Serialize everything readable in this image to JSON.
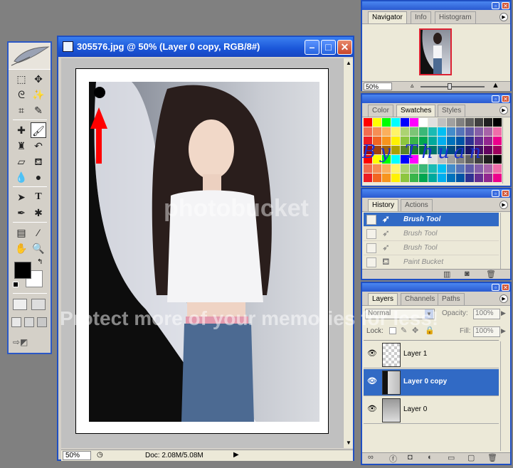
{
  "document": {
    "title": "305576.jpg @ 50% (Layer 0 copy, RGB/8#)",
    "zoom": "50%",
    "doc_size": "Doc: 2.08M/5.08M"
  },
  "navigator": {
    "tabs": [
      "Navigator",
      "Info",
      "Histogram"
    ],
    "zoom": "50%"
  },
  "color_panel": {
    "tabs": [
      "Color",
      "Swatches",
      "Styles"
    ],
    "signature": "By Thuan",
    "swatch_colors": [
      "#ff0000",
      "#ffff00",
      "#00ff00",
      "#00ffff",
      "#0000ff",
      "#ff00ff",
      "#ffffff",
      "#e0e0e0",
      "#c0c0c0",
      "#a0a0a0",
      "#808080",
      "#606060",
      "#404040",
      "#202020",
      "#000000",
      "#f26c4f",
      "#f68e55",
      "#fbaf5d",
      "#fff467",
      "#acd372",
      "#7cc576",
      "#3bb878",
      "#1abbb4",
      "#00bff3",
      "#438ccb",
      "#5574b9",
      "#605ca8",
      "#855fa8",
      "#a763a8",
      "#f06eaa",
      "#ed1c24",
      "#f26522",
      "#f7941d",
      "#fff200",
      "#8dc63f",
      "#39b54a",
      "#00a651",
      "#00a99d",
      "#00aeef",
      "#0072bc",
      "#0054a6",
      "#2e3192",
      "#662d91",
      "#92278f",
      "#ec008c",
      "#9e0b0f",
      "#a0410d",
      "#a36209",
      "#aba000",
      "#598527",
      "#197b30",
      "#007236",
      "#00746b",
      "#0076a3",
      "#004b80",
      "#003471",
      "#1b1464",
      "#440e62",
      "#630460",
      "#9e005d"
    ]
  },
  "history": {
    "tabs": [
      "History",
      "Actions"
    ],
    "items": [
      {
        "label": "Brush Tool",
        "active": true,
        "icon": "brush-icon"
      },
      {
        "label": "Brush Tool",
        "active": false,
        "icon": "brush-icon"
      },
      {
        "label": "Brush Tool",
        "active": false,
        "icon": "brush-icon"
      },
      {
        "label": "Paint Bucket",
        "active": false,
        "icon": "paint-bucket-icon"
      }
    ]
  },
  "layers": {
    "tabs": [
      "Layers",
      "Channels",
      "Paths"
    ],
    "blend_mode": "Normal",
    "opacity_label": "Opacity:",
    "opacity": "100%",
    "lock_label": "Lock:",
    "fill_label": "Fill:",
    "fill": "100%",
    "items": [
      {
        "label": "Layer 1",
        "active": false
      },
      {
        "label": "Layer 0 copy",
        "active": true
      },
      {
        "label": "Layer 0",
        "active": false
      }
    ]
  },
  "watermark": {
    "line1": "photobucket",
    "line2": "Protect more of your memories for less!"
  },
  "colors": {
    "titlebar": "#1a55d8",
    "panel_bg": "#ece9d8",
    "selection": "#316ac5",
    "canvas_bg": "#c0c0c0",
    "arrow": "#ff0000"
  }
}
